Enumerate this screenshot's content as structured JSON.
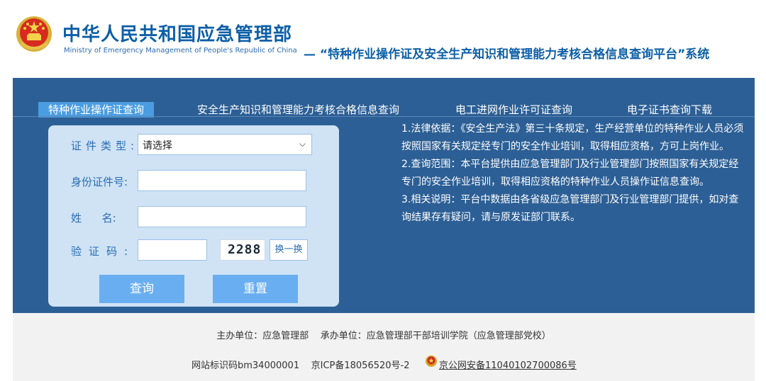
{
  "header": {
    "ministry_cn": "中华人民共和国应急管理部",
    "ministry_en": "Ministry of Emergency Management of People's Republic of China",
    "platform_title": "— “特种作业操作证及安全生产知识和管理能力考核合格信息查询平台”系统"
  },
  "tabs": [
    {
      "label": "特种作业操作证查询",
      "active": true
    },
    {
      "label": "安全生产知识和管理能力考核合格信息查询",
      "active": false
    },
    {
      "label": "电工进网作业许可证查询",
      "active": false
    },
    {
      "label": "电子证书查询下载",
      "active": false
    }
  ],
  "form": {
    "cert_type_label": "证件类型:",
    "cert_type_value": "请选择",
    "id_label": "身份证件号:",
    "id_value": "",
    "name_label": "姓      名:",
    "name_value": "",
    "captcha_label": "验证码:",
    "captcha_value": "",
    "captcha_image_text": "2288",
    "swap_label": "换一换",
    "query_label": "查询",
    "reset_label": "重置"
  },
  "info": {
    "p1": "1.法律依据：《安全生产法》第三十条规定，生产经营单位的特种作业人员必须按照国家有关规定经专门的安全作业培训，取得相应资格，方可上岗作业。",
    "p2": "2.查询范围：本平台提供由应急管理部门及行业管理部门按照国家有关规定经专门的安全作业培训，取得相应资格的特种作业人员操作证信息查询。",
    "p3": "3.相关说明：平台中数据由各省级应急管理部门及行业管理部门提供，如对查询结果存有疑问，请与原发证部门联系。"
  },
  "footer": {
    "line1": "主办单位：应急管理部    承办单位：应急管理部干部培训学院（应急管理部党校）",
    "site_code": "网站标识码bm34000001    京ICP备18056520号-2",
    "police_link": "京公网安备11040102700086号"
  },
  "colors": {
    "panel": "#2c5f95",
    "active_tab": "#4a9de0",
    "button": "#69aef0",
    "brand_blue": "#0d5fa7"
  }
}
